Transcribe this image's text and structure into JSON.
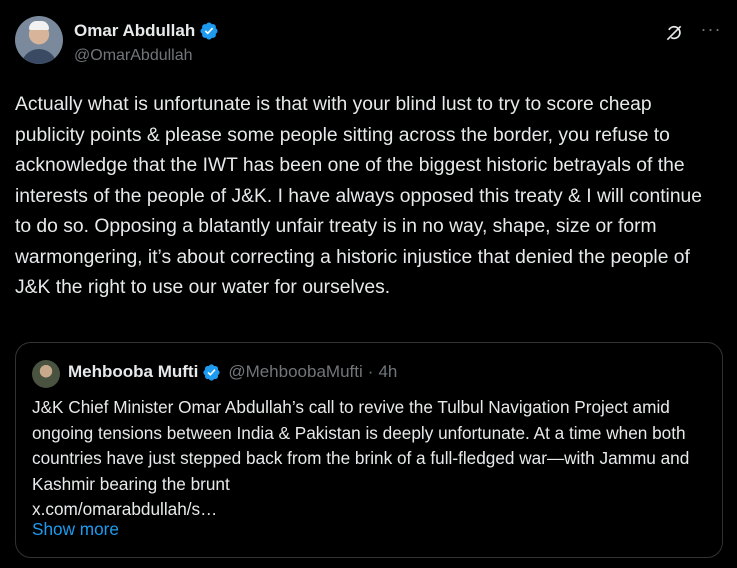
{
  "author": {
    "name": "Omar Abdullah",
    "handle": "@OmarAbdullah"
  },
  "tweet": {
    "text": "Actually what is unfortunate is that with your blind lust to try to score cheap publicity points & please some people sitting across the border, you refuse to acknowledge that the IWT has been one of the biggest historic betrayals of the interests of the people of J&K. I have always opposed this treaty & I will continue to do so. Opposing a blatantly unfair treaty is in no way, shape, size or form warmongering, it’s about correcting a historic injustice that denied the people of J&K the right to use our water for ourselves."
  },
  "quote": {
    "name": "Mehbooba Mufti",
    "handle": "@MehboobaMufti",
    "separator": "·",
    "time": "4h",
    "text": "J&K Chief Minister Omar Abdullah’s call to revive the Tulbul Navigation Project amid ongoing tensions between India & Pakistan is deeply unfortunate. At a time when both countries have just stepped back from the brink of a full-fledged war—with Jammu and Kashmir bearing the brunt",
    "link": "x.com/omarabdullah/s…",
    "show_more": "Show more"
  },
  "icons": {
    "verified": "verified-badge-icon",
    "grok": "grok-icon",
    "more": "more-icon"
  },
  "colors": {
    "background": "#000000",
    "text": "#e7e9ea",
    "muted": "#71767b",
    "accent": "#1d9bf0",
    "border": "#2f3336"
  }
}
